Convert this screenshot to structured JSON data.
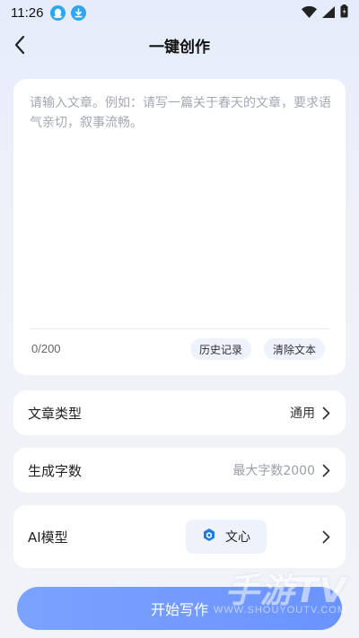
{
  "status_bar": {
    "time": "11:26",
    "icons": [
      "qq-icon",
      "download-icon",
      "wifi-icon",
      "signal-icon",
      "battery-icon"
    ],
    "colors": {
      "qq": "#2ea6f2",
      "download": "#2ea6f2"
    }
  },
  "header": {
    "title": "一键创作"
  },
  "editor": {
    "placeholder": "请输入文章。例如：请写一篇关于春天的文章，要求语气亲切，叙事流畅。",
    "value": "",
    "counter": "0/200",
    "history_label": "历史记录",
    "clear_label": "清除文本"
  },
  "settings": {
    "article_type": {
      "label": "文章类型",
      "value": "通用"
    },
    "word_count": {
      "label": "生成字数",
      "value": "最大字数2000"
    },
    "model": {
      "label": "AI模型",
      "value": "文心",
      "icon": "wenxin-logo-icon"
    }
  },
  "actions": {
    "start_label": "开始写作"
  },
  "watermark": {
    "main": "手游TV",
    "sub": "WWW.SHOUYOUTV.COM"
  },
  "theme": {
    "accent": "#6b93ff",
    "card": "#ffffff",
    "chip": "#eef2fa"
  }
}
